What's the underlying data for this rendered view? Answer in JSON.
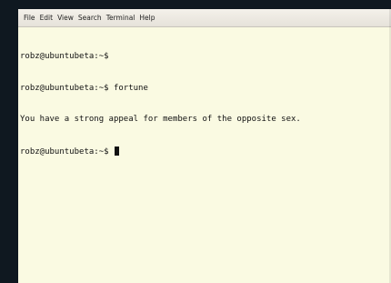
{
  "menubar": {
    "items": [
      "File",
      "Edit",
      "View",
      "Search",
      "Terminal",
      "Help"
    ]
  },
  "terminal": {
    "lines": [
      "robz@ubuntubeta:~$",
      "robz@ubuntubeta:~$ fortune",
      "You have a strong appeal for members of the opposite sex.",
      "robz@ubuntubeta:~$ "
    ]
  },
  "colors": {
    "background": "#fafae2",
    "text": "#111111",
    "desktop": "#0f1820"
  }
}
